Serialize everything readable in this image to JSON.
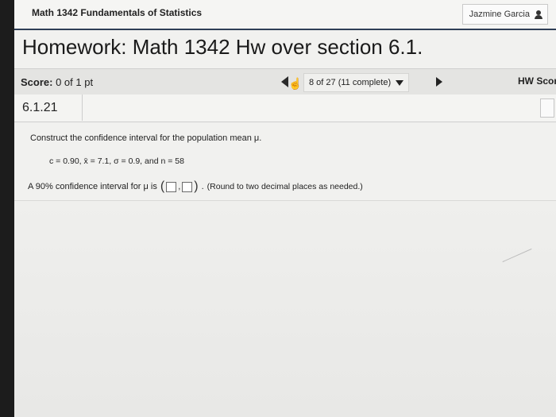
{
  "header": {
    "course_title": "Math 1342 Fundamentals of Statistics",
    "user_name": "Jazmine Garcia",
    "user_icon": "user-icon"
  },
  "homework": {
    "title": "Homework: Math 1342 Hw over section 6.1."
  },
  "scorebar": {
    "score_label": "Score:",
    "score_value": "0 of 1 pt",
    "progress_text": "8 of 27 (11 complete)",
    "hw_score_label": "HW Score"
  },
  "question": {
    "number": "6.1.21",
    "prompt": "Construct the confidence interval for the population mean μ.",
    "given": "c = 0.90, x̄ = 7.1, σ = 0.9, and n = 58",
    "answer_prefix": "A 90% confidence interval for μ is",
    "answer_open": "(",
    "answer_sep": ",",
    "answer_close": ")",
    "answer_suffix": ".",
    "round_note": "(Round to two decimal places as needed.)",
    "lower_value": "",
    "upper_value": ""
  }
}
